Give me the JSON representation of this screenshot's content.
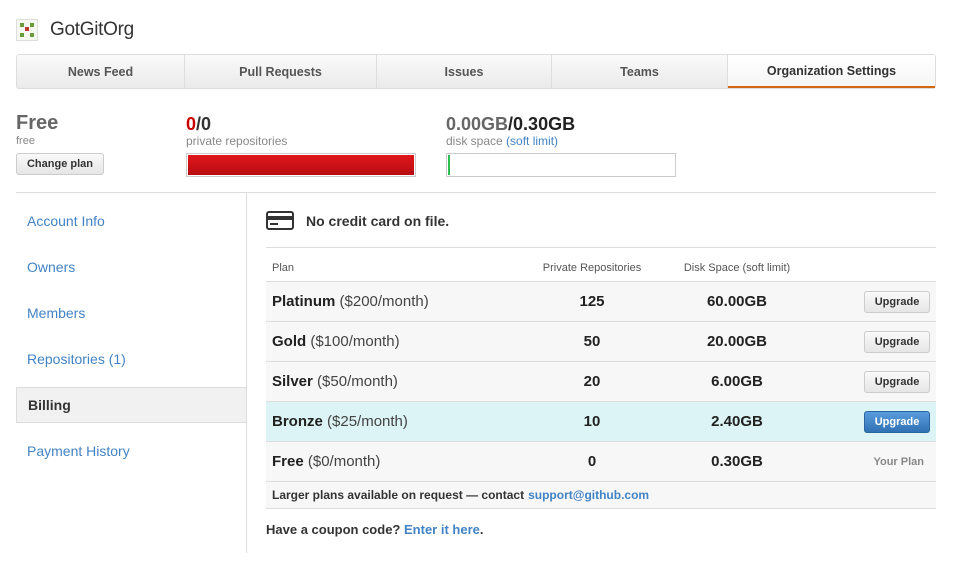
{
  "org": {
    "name": "GotGitOrg"
  },
  "tabs": [
    {
      "label": "News Feed",
      "width": 168
    },
    {
      "label": "Pull Requests",
      "width": 192
    },
    {
      "label": "Issues",
      "width": 175
    },
    {
      "label": "Teams",
      "width": 176
    },
    {
      "label": "Organization Settings",
      "width": 207,
      "active": true
    }
  ],
  "summary": {
    "plan": {
      "name": "Free",
      "sub": "free",
      "change_label": "Change plan"
    },
    "repos": {
      "used": "0",
      "total": "/0",
      "label": "private repositories",
      "fill_fraction": 1.0
    },
    "disk": {
      "used": "0.00GB",
      "total": "/0.30GB",
      "label": "disk space",
      "soft_limit_link": "(soft limit)",
      "fill_fraction": 0.0
    }
  },
  "sidebar": {
    "items": [
      {
        "label": "Account Info"
      },
      {
        "label": "Owners"
      },
      {
        "label": "Members"
      },
      {
        "label": "Repositories (1)"
      },
      {
        "label": "Billing",
        "selected": true
      },
      {
        "label": "Payment History"
      }
    ]
  },
  "billing": {
    "no_card": "No credit card on file.",
    "headers": {
      "plan": "Plan",
      "repos": "Private Repositories",
      "disk": "Disk Space (soft limit)"
    },
    "plans": [
      {
        "name": "Platinum",
        "price": "($200/month)",
        "repos": "125",
        "disk": "60.00GB",
        "action": "Upgrade"
      },
      {
        "name": "Gold",
        "price": "($100/month)",
        "repos": "50",
        "disk": "20.00GB",
        "action": "Upgrade"
      },
      {
        "name": "Silver",
        "price": "($50/month)",
        "repos": "20",
        "disk": "6.00GB",
        "action": "Upgrade"
      },
      {
        "name": "Bronze",
        "price": "($25/month)",
        "repos": "10",
        "disk": "2.40GB",
        "action": "Upgrade",
        "highlight": true
      },
      {
        "name": "Free",
        "price": "($0/month)",
        "repos": "0",
        "disk": "0.30GB",
        "action": "Your Plan",
        "current": true
      }
    ],
    "larger_note": "Larger plans available on request — contact",
    "support_email": "support@github.com",
    "coupon_text": "Have a coupon code?",
    "coupon_link": "Enter it here",
    "coupon_period": "."
  },
  "colors": {
    "accent": "#d26911",
    "link": "#4183c4",
    "repo_bar": "#cc1016",
    "disk_bar": "#2cbe4e",
    "highlight_row": "#dcf4f6",
    "primary_button": "#4182c3"
  },
  "icons": {
    "org_avatar": "identicon",
    "card": "credit-card-icon"
  }
}
